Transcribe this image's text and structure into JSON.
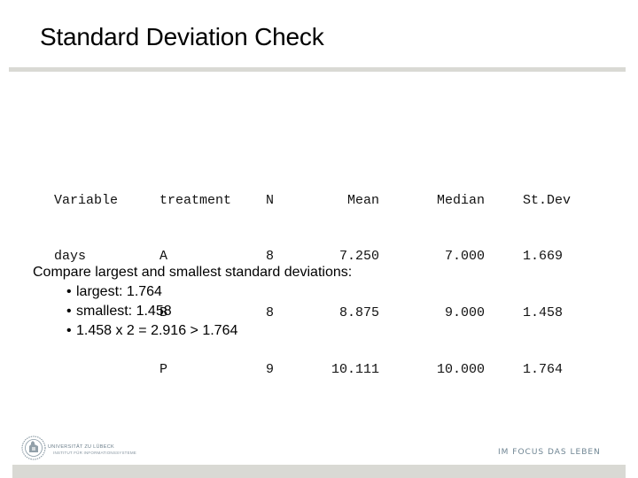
{
  "slide": {
    "title": "Standard Deviation Check"
  },
  "stats_output": {
    "columns": {
      "variable": {
        "header": "Variable",
        "cells": [
          "days",
          "",
          ""
        ]
      },
      "treatment": {
        "header": "treatment",
        "cells": [
          "A",
          "B",
          "P"
        ]
      },
      "n": {
        "header": "N",
        "cells": [
          "8",
          "8",
          "9"
        ]
      },
      "mean": {
        "header": "Mean",
        "cells": [
          "7.250",
          "8.875",
          "10.111"
        ]
      },
      "median": {
        "header": "Median",
        "cells": [
          "7.000",
          "9.000",
          "10.000"
        ]
      },
      "stdev": {
        "header": "St.Dev",
        "cells": [
          "1.669",
          "1.458",
          "1.764"
        ]
      }
    }
  },
  "comparison": {
    "heading": "Compare largest and smallest standard deviations:",
    "bullet_symbol": "•",
    "bullets": [
      "largest: 1.764",
      "smallest: 1.458",
      "1.458 x 2 = 2.916 > 1.764"
    ]
  },
  "footer": {
    "institution_name": "UNIVERSITÄT ZU LÜBECK",
    "institution_subtitle": "INSTITUT FÜR INFORMATIONSSYSTEME",
    "slogan": "IM FOCUS DAS LEBEN"
  },
  "colors": {
    "rule": "#d9d9d4",
    "slogan": "#6f8593",
    "text": "#000000"
  }
}
